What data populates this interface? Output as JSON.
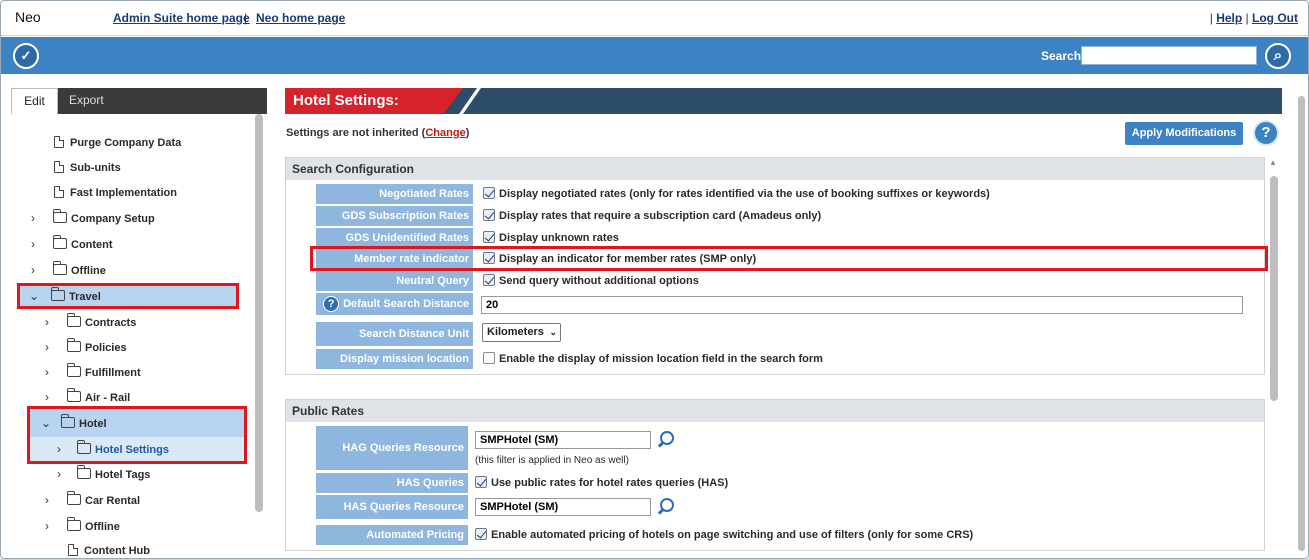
{
  "topbar": {
    "app_name": "Neo",
    "admin_link": "Admin Suite home page",
    "separator": "|",
    "neo_link": "Neo home page",
    "help": "Help",
    "logout": "Log Out"
  },
  "header": {
    "search_label": "Search",
    "search_value": ""
  },
  "left_tabs": {
    "edit": "Edit",
    "export": "Export"
  },
  "tree": [
    {
      "label": "Purge Company Data",
      "type": "doc"
    },
    {
      "label": "Sub-units",
      "type": "doc"
    },
    {
      "label": "Fast Implementation",
      "type": "doc"
    },
    {
      "label": "Company Setup",
      "type": "folder"
    },
    {
      "label": "Content",
      "type": "folder"
    },
    {
      "label": "Offline",
      "type": "folder"
    },
    {
      "label": "Travel",
      "type": "folder-open"
    },
    {
      "label": "Contracts",
      "type": "folder"
    },
    {
      "label": "Policies",
      "type": "folder"
    },
    {
      "label": "Fulfillment",
      "type": "folder"
    },
    {
      "label": "Air - Rail",
      "type": "folder"
    },
    {
      "label": "Hotel",
      "type": "folder-open"
    },
    {
      "label": "Hotel Settings",
      "type": "folder"
    },
    {
      "label": "Hotel Tags",
      "type": "folder"
    },
    {
      "label": "Car Rental",
      "type": "folder"
    },
    {
      "label": "Offline",
      "type": "folder"
    },
    {
      "label": "Content Hub",
      "type": "doc"
    }
  ],
  "main": {
    "title": "Hotel Settings:",
    "inherit_text": "Settings are not inherited (",
    "inherit_link": "Change",
    "inherit_close": ")",
    "apply_button": "Apply Modifications",
    "help_icon": "?"
  },
  "search_config": {
    "header": "Search Configuration",
    "rows": [
      {
        "label": "Negotiated Rates",
        "checked": true,
        "text": "Display negotiated rates (only for rates identified via the use of booking suffixes or keywords)"
      },
      {
        "label": "GDS Subscription Rates",
        "checked": true,
        "text": "Display rates that require a subscription card (Amadeus only)"
      },
      {
        "label": "GDS Unidentified Rates",
        "checked": true,
        "text": "Display unknown rates"
      },
      {
        "label": "Member rate indicator",
        "checked": true,
        "text": "Display an indicator for member rates (SMP only)"
      },
      {
        "label": "Neutral Query",
        "checked": true,
        "text": "Send query without additional options"
      },
      {
        "label": "Default Search Distance",
        "value": "20"
      },
      {
        "label": "Search Distance Unit",
        "value": "Kilometers"
      },
      {
        "label": "Display mission location",
        "checked": false,
        "text": "Enable the display of mission location field in the search form"
      }
    ]
  },
  "public_rates": {
    "header": "Public Rates",
    "hag_label": "HAG Queries Resource",
    "hag_value": "SMPHotel (SM)",
    "hag_note": "(this filter is applied in Neo as well)",
    "has_label": "HAS Queries",
    "has_text": "Use public rates for hotel rates queries (HAS)",
    "has_res_label": "HAS Queries Resource",
    "has_res_value": "SMPHotel (SM)",
    "auto_label": "Automated Pricing",
    "auto_text": "Enable automated pricing of hotels on page switching and use of filters (only for some CRS)"
  }
}
